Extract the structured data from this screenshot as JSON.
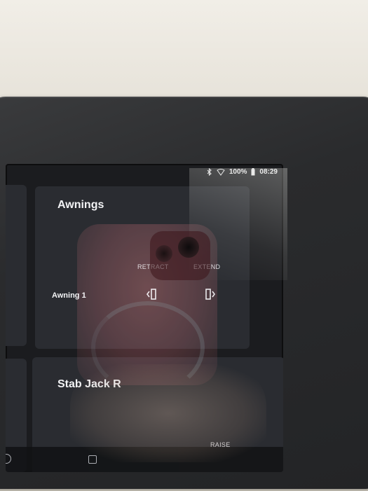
{
  "status_bar": {
    "battery_percent": "100%",
    "time": "08:29",
    "icons": [
      "bluetooth-icon",
      "wifi-icon",
      "battery-icon"
    ]
  },
  "awnings_card": {
    "title": "Awnings",
    "columns": {
      "retract": "RETRACT",
      "extend": "EXTEND"
    },
    "rows": [
      {
        "label": "Awning 1",
        "retract_icon": "awning-retract-icon",
        "extend_icon": "awning-extend-icon"
      }
    ]
  },
  "stab_jack_card": {
    "title": "Stab Jack R",
    "raise_label": "RAISE"
  },
  "left_panel": {
    "indicator_color": "#f1c23a"
  },
  "nav_bar": {
    "icons": [
      "back-icon",
      "home-icon"
    ]
  },
  "colors": {
    "card_bg": "#2a2c31",
    "screen_bg": "#1b1c1f",
    "text_primary": "#f2f3f5",
    "accent_yellow": "#f1c23a"
  }
}
